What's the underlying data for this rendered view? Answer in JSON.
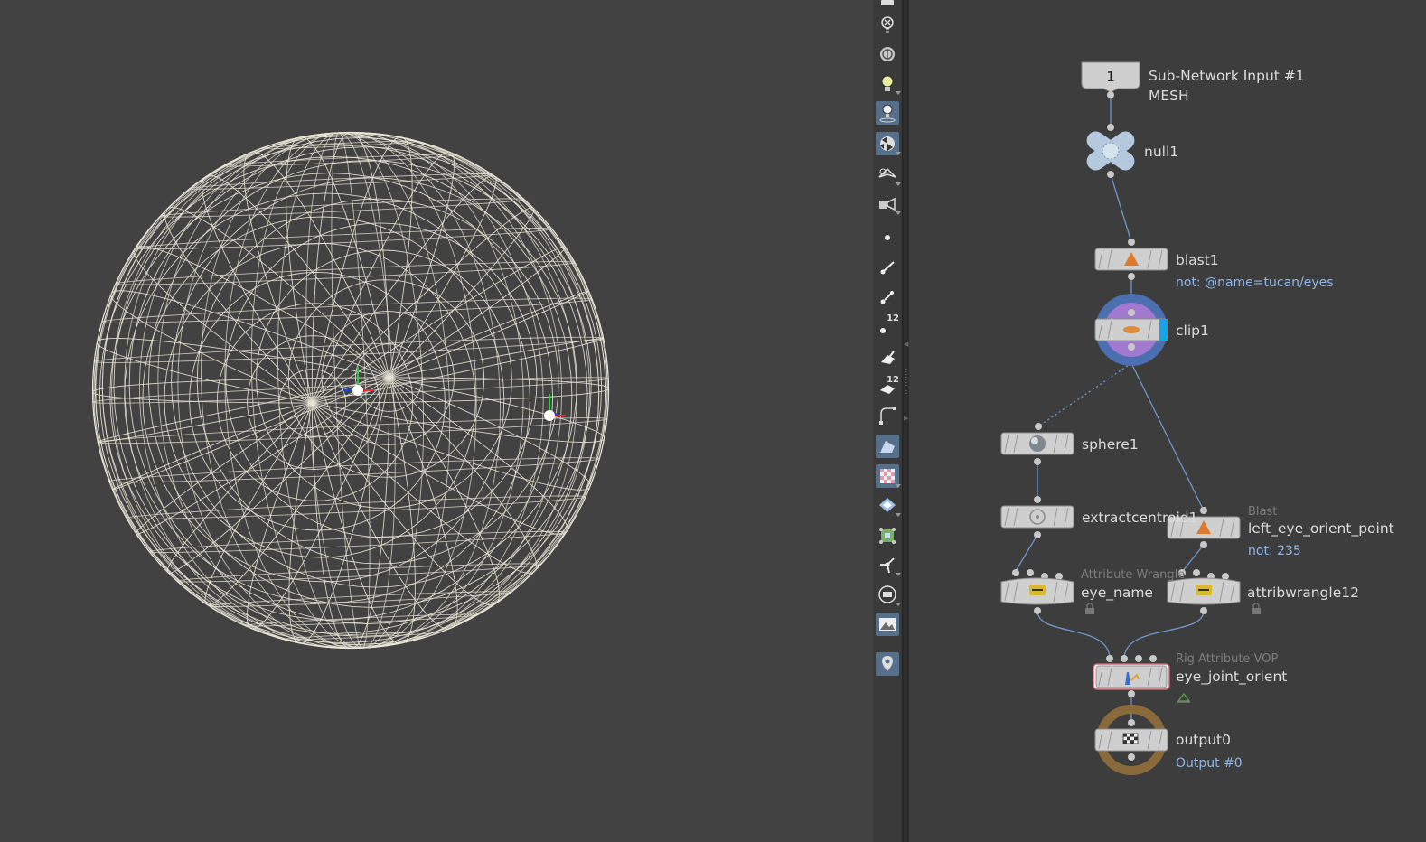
{
  "toolbar": {
    "tools": [
      {
        "name": "bottom-menu-icon"
      },
      {
        "name": "ghost-other-objects-icon"
      },
      {
        "name": "display-options-icon"
      },
      {
        "name": "lighting-icon"
      },
      {
        "name": "headlight-icon"
      },
      {
        "name": "shading-mode-icon"
      },
      {
        "name": "camera-view-icon"
      },
      {
        "name": "camera-menu-icon"
      },
      {
        "name": "point-display-icon"
      },
      {
        "name": "point-normals-icon"
      },
      {
        "name": "point-markers-icon"
      },
      {
        "name": "point-numbers-icon",
        "badge": "12"
      },
      {
        "name": "primitive-normals-icon"
      },
      {
        "name": "primitive-numbers-icon",
        "badge": "12"
      },
      {
        "name": "hull-display-icon"
      },
      {
        "name": "shading-open-curves-icon"
      },
      {
        "name": "texture-checker-icon"
      },
      {
        "name": "backface-icon"
      },
      {
        "name": "unique-points-icon"
      },
      {
        "name": "vertex-normals-icon"
      },
      {
        "name": "guide-display-icon"
      },
      {
        "name": "background-image-icon"
      },
      {
        "name": "pin-viewport-icon"
      }
    ]
  },
  "network": {
    "nodes": {
      "subnet_input": {
        "badge": "1",
        "label": "Sub-Network Input #1",
        "sublabel": "MESH"
      },
      "null1": {
        "label": "null1"
      },
      "blast1": {
        "label": "blast1",
        "comment": "not: @name=tucan/eyes"
      },
      "clip1": {
        "label": "clip1"
      },
      "sphere1": {
        "label": "sphere1"
      },
      "extractcentroid1": {
        "label": "extractcentroid1"
      },
      "left_eye_orient_point": {
        "type": "Blast",
        "label": "left_eye_orient_point",
        "comment": "not: 235"
      },
      "eye_name": {
        "type": "Attribute Wrangle",
        "label": "eye_name"
      },
      "attribwrangle12": {
        "label": "attribwrangle12"
      },
      "eye_joint_orient": {
        "type": "Rig Attribute VOP",
        "label": "eye_joint_orient"
      },
      "output0": {
        "label": "output0",
        "comment": "Output #0"
      }
    }
  },
  "colors": {
    "viewport_bg": "#424242",
    "network_bg": "#3d3d3d",
    "wire": "#6f97c9",
    "node_body": "#cfcfcf",
    "comment": "#8fb6ea",
    "wireframe": "#e8e6d6",
    "template_ring": "#4b6fb0",
    "display_ring": "#8a6a3a",
    "clip_bypass_flag": "#18a3e6"
  }
}
